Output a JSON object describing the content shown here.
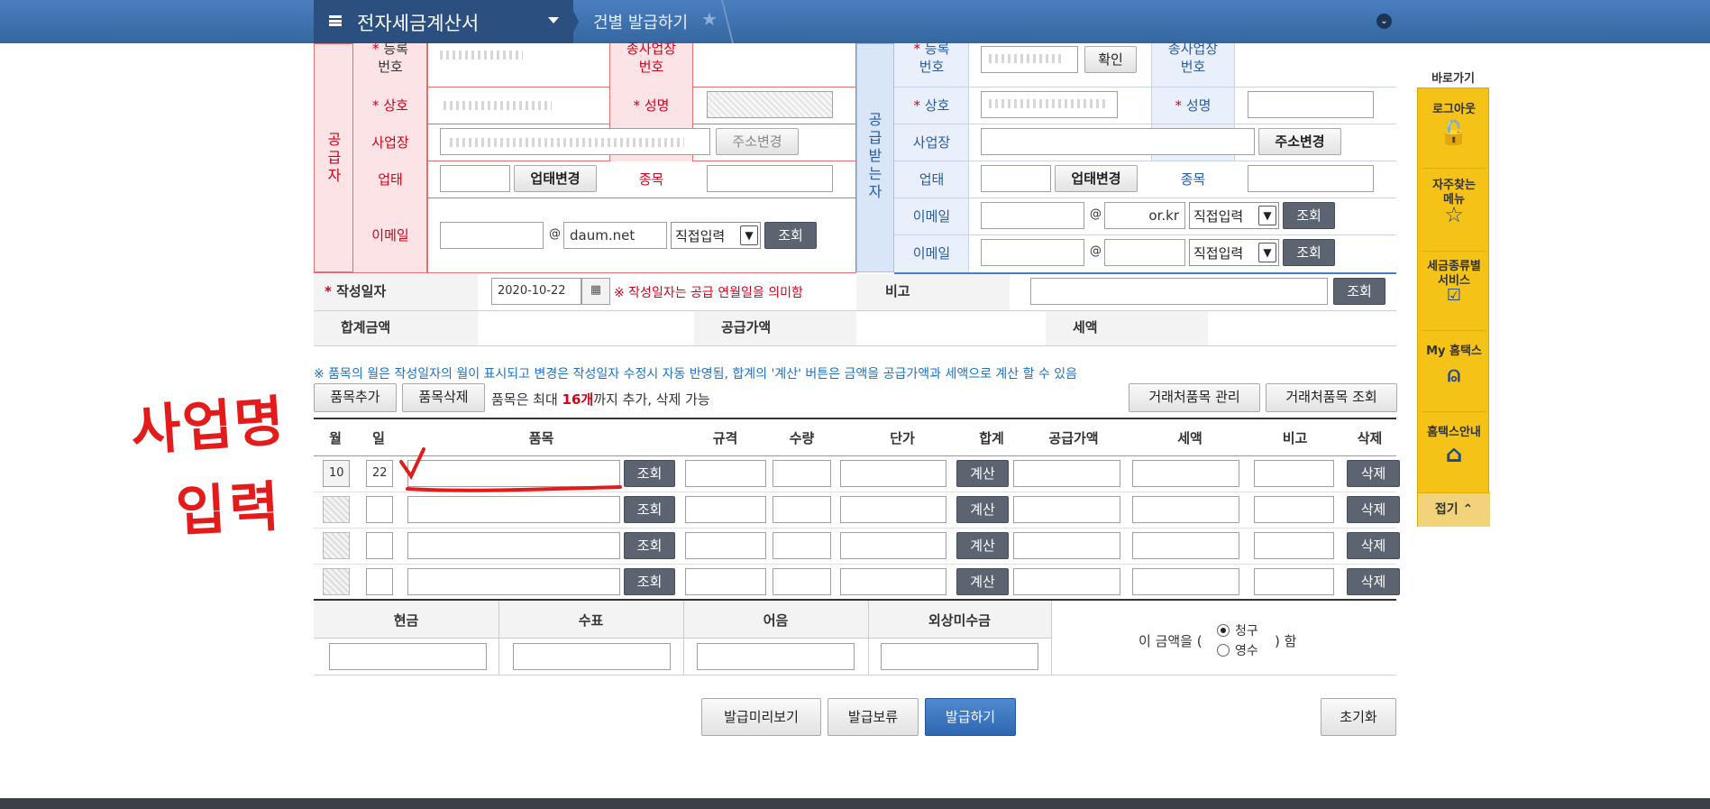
{
  "topbar": {
    "menu_title": "전자세금계산서",
    "breadcrumb": "건별 발급하기"
  },
  "supplier": {
    "section_label": "공급자",
    "reg_no_label": "등록\n번호",
    "sub_office_label": "종사업장\n번호",
    "company_label": "상호",
    "ceo_label": "성명",
    "address_label": "사업장",
    "address_btn": "주소변경",
    "biz_type_label": "업태",
    "biz_type_btn": "업태변경",
    "item_label": "종목",
    "email_label": "이메일",
    "email_at": "@",
    "email_domain": "daum.net",
    "email_select": "직접입력",
    "email_search_btn": "조회"
  },
  "receiver": {
    "section_label": "공급받는자",
    "reg_no_label": "등록\n번호",
    "confirm_btn": "확인",
    "sub_office_label": "종사업장\n번호",
    "company_label": "상호",
    "ceo_label": "성명",
    "address_label": "사업장",
    "address_btn": "주소변경",
    "biz_type_label": "업태",
    "biz_type_btn": "업태변경",
    "item_label": "종목",
    "email1_label": "이메일",
    "email1_domain": "or.kr",
    "email_at": "@",
    "email_select": "직접입력",
    "email_search_btn": "조회",
    "email2_label": "이메일"
  },
  "date_row": {
    "label": "작성일자",
    "value": "2020-10-22",
    "note": "※ 작성일자는 공급 연월일을 의미함",
    "remark_label": "비고",
    "search_btn": "조회"
  },
  "sum_row": {
    "total_label": "합계금액",
    "supply_label": "공급가액",
    "tax_label": "세액"
  },
  "notice": "※ 품목의 월은 작성일자의 월이 표시되고 변경은 작성일자 수정시 자동 반영됨, 합계의 '계산' 버튼은 금액을 공급가액과 세액으로 계산 할 수 있음",
  "item_toolbar": {
    "add_btn": "품목추가",
    "delete_btn": "품목삭제",
    "limit_pre": "품목은 최대 ",
    "limit_num": "16개",
    "limit_post": "까지 추가, 삭제 가능",
    "manage_btn": "거래처품목 관리",
    "lookup_btn": "거래처품목 조회"
  },
  "item_table": {
    "headers": [
      "월",
      "일",
      "품목",
      "규격",
      "수량",
      "단가",
      "합계",
      "공급가액",
      "세액",
      "비고",
      "삭제"
    ],
    "first_month": "10",
    "first_day": "22",
    "search_btn": "조회",
    "calc_btn": "계산",
    "delete_btn": "삭제"
  },
  "payment": {
    "headers": [
      "현금",
      "수표",
      "어음",
      "외상미수금"
    ],
    "amount_pre": "이 금액을 (",
    "claim": "청구",
    "receipt": "영수",
    "amount_post": ") 함"
  },
  "bottom_buttons": {
    "preview": "발급미리보기",
    "hold": "발급보류",
    "issue": "발급하기",
    "reset": "초기화"
  },
  "quick_menu": {
    "title": "바로가기",
    "items": [
      "로그아웃",
      "자주찾는\n메뉴",
      "세금종류별\n서비스",
      "My 홈택스",
      "홈택스안내"
    ],
    "fold": "접기"
  },
  "annotation": {
    "line1": "사업명",
    "line2": "입력"
  },
  "colors": {
    "supplier_bg": "#fbe3e6",
    "receiver_bg": "#d8e6f8",
    "accent": "#d0021b",
    "topbar": "#3a6ea8"
  }
}
